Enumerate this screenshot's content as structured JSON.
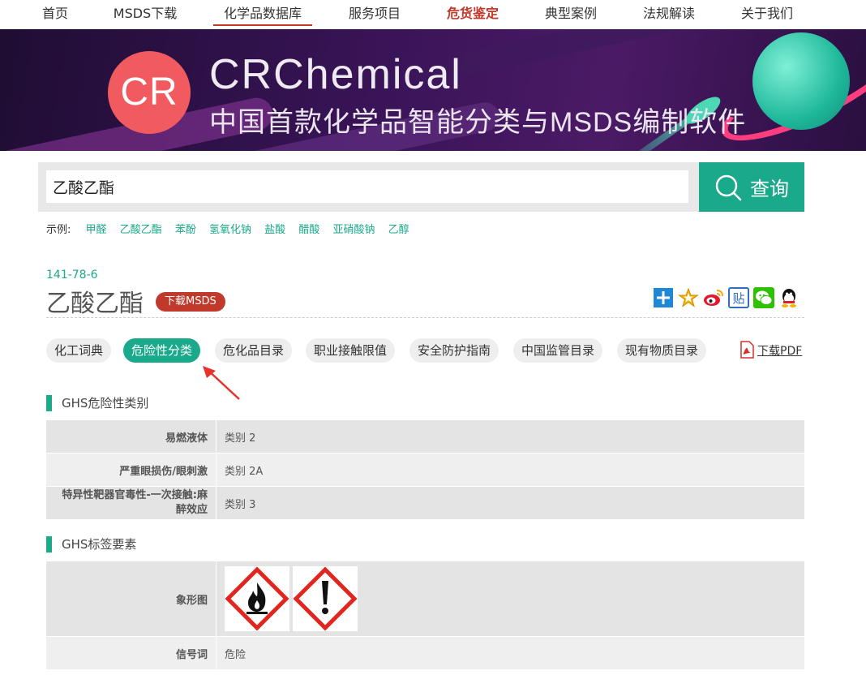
{
  "nav": {
    "items": [
      {
        "label": "首页"
      },
      {
        "label": "MSDS下载"
      },
      {
        "label": "化学品数据库"
      },
      {
        "label": "服务项目"
      },
      {
        "label": "危货鉴定"
      },
      {
        "label": "典型案例"
      },
      {
        "label": "法规解读"
      },
      {
        "label": "关于我们"
      }
    ]
  },
  "banner": {
    "logo_text": "CR",
    "brand": "CRChemical",
    "slogan": "中国首款化学品智能分类与MSDS编制软件"
  },
  "search": {
    "value": "乙酸乙酯",
    "button_label": "查询",
    "examples_label": "示例:",
    "examples": [
      "甲醛",
      "乙酸乙酯",
      "苯酚",
      "氢氧化钠",
      "盐酸",
      "醋酸",
      "亚硝酸钠",
      "乙醇"
    ]
  },
  "chemical": {
    "cas": "141-78-6",
    "name": "乙酸乙酯",
    "download_label": "下载MSDS"
  },
  "share_icons": [
    "plus-share-icon",
    "star-icon",
    "weibo-icon",
    "tieba-icon",
    "wechat-icon",
    "qq-icon"
  ],
  "tabs": [
    {
      "label": "化工词典"
    },
    {
      "label": "危险性分类"
    },
    {
      "label": "危化品目录"
    },
    {
      "label": "职业接触限值"
    },
    {
      "label": "安全防护指南"
    },
    {
      "label": "中国监管目录"
    },
    {
      "label": "现有物质目录"
    }
  ],
  "pdf_label": "下载PDF",
  "ghs_class": {
    "title": "GHS危险性类别",
    "rows": [
      {
        "label": "易燃液体",
        "value": "类别 2"
      },
      {
        "label": "严重眼损伤/眼刺激",
        "value": "类别 2A"
      },
      {
        "label": "特异性靶器官毒性-一次接触:麻醉效应",
        "value": "类别 3"
      }
    ]
  },
  "ghs_label": {
    "title": "GHS标签要素",
    "pictogram_label": "象形图",
    "pictograms": [
      "flame-pictogram-icon",
      "exclamation-pictogram-icon"
    ],
    "signal_label": "信号词",
    "signal_value": "危险"
  },
  "colors": {
    "accent": "#1aa98b",
    "hot": "#c0392b",
    "pictogram_border": "#e2251f"
  }
}
